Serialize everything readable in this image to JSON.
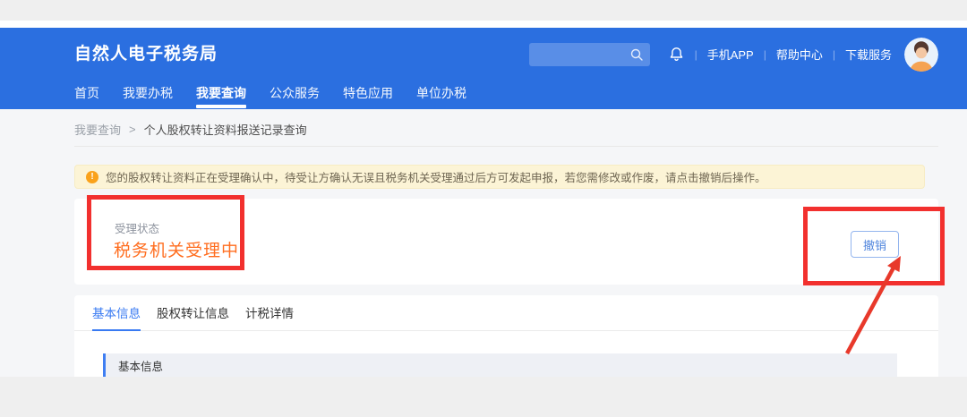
{
  "colors": {
    "header_blue": "#2b6fe0",
    "accent_blue": "#387af2",
    "status_orange": "#ff6e20",
    "warning_bg": "#fcf4d6",
    "warning_icon_orange": "#faa21b",
    "annotation_red": "#f2302e"
  },
  "header": {
    "title": "自然人电子税务局",
    "search": {
      "value": ""
    },
    "links": [
      {
        "label": "手机APP"
      },
      {
        "label": "帮助中心"
      },
      {
        "label": "下载服务"
      }
    ]
  },
  "nav": {
    "items": [
      {
        "label": "首页",
        "active": false
      },
      {
        "label": "我要办税",
        "active": false
      },
      {
        "label": "我要查询",
        "active": true
      },
      {
        "label": "公众服务",
        "active": false
      },
      {
        "label": "特色应用",
        "active": false
      },
      {
        "label": "单位办税",
        "active": false
      }
    ]
  },
  "breadcrumb": {
    "parent": "我要查询",
    "separator": ">",
    "current": "个人股权转让资料报送记录查询"
  },
  "notice": {
    "text": "您的股权转让资料正在受理确认中，待受让方确认无误且税务机关受理通过后方可发起申报，若您需修改或作废，请点击撤销后操作。"
  },
  "status_card": {
    "label": "受理状态",
    "value": "税务机关受理中",
    "action_button": "撤销"
  },
  "detail_tabs": {
    "items": [
      {
        "label": "基本信息",
        "active": true
      },
      {
        "label": "股权转让信息",
        "active": false
      },
      {
        "label": "计税详情",
        "active": false
      }
    ]
  },
  "section": {
    "title": "基本信息"
  }
}
